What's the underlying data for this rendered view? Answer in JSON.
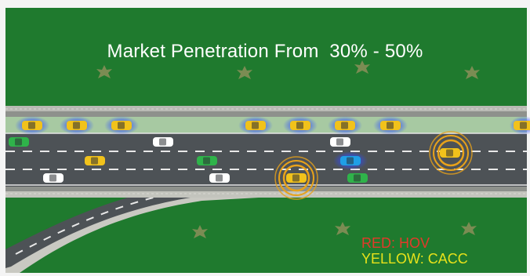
{
  "title": "Market Penetration From  30% - 50%",
  "legend": {
    "hov": "RED: HOV",
    "cacc": "YELLOW:  CACC"
  },
  "colors": {
    "grass": "#1f7a2e",
    "road": "#4d5256",
    "hov_lane": "#a7c9a2",
    "cacc_car": "#f1c21b",
    "hov_legend": "#e23a2a",
    "cacc_legend": "#e8e21a"
  },
  "icons": [
    "tree-icon",
    "car-icon",
    "target-ring-icon"
  ]
}
